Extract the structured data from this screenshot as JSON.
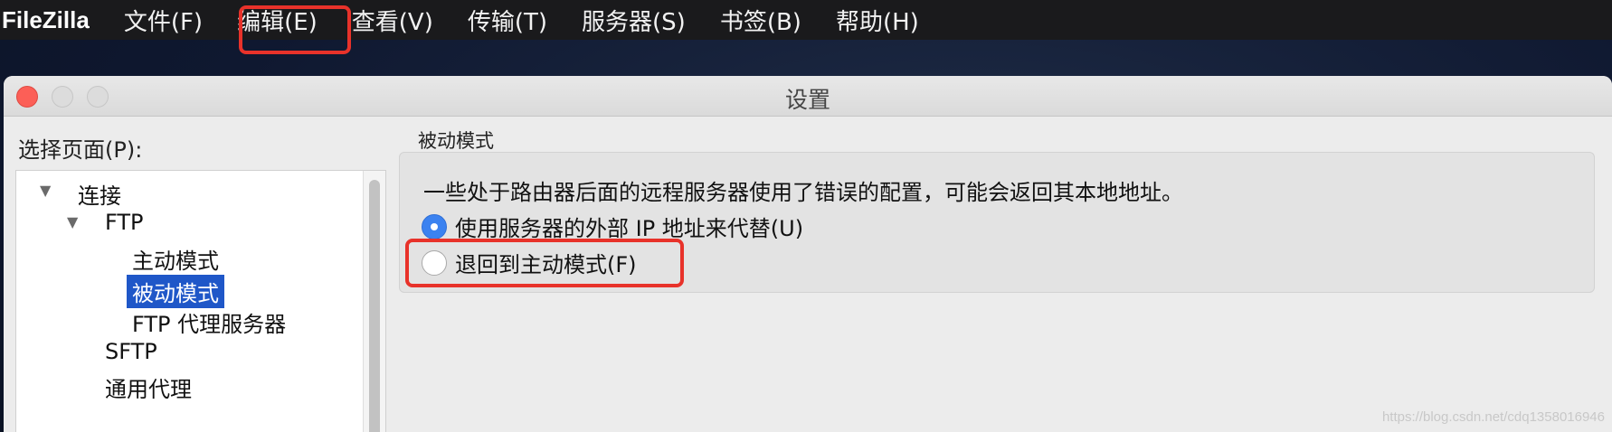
{
  "menubar": {
    "app_name": "FileZilla",
    "items": [
      "文件(F)",
      "编辑(E)",
      "查看(V)",
      "传输(T)",
      "服务器(S)",
      "书签(B)",
      "帮助(H)"
    ]
  },
  "dialog": {
    "title": "设置",
    "page_select_label": "选择页面(P):",
    "tree": {
      "connection": "连接",
      "ftp": "FTP",
      "active_mode": "主动模式",
      "passive_mode": "被动模式",
      "ftp_proxy": "FTP 代理服务器",
      "sftp": "SFTP",
      "generic_proxy": "通用代理"
    },
    "section_title": "被动模式",
    "description": "一些处于路由器后面的远程服务器使用了错误的配置，可能会返回其本地地址。",
    "options": {
      "use_external_ip": {
        "label": "使用服务器的外部 IP 地址来代替(U)",
        "selected": true
      },
      "fallback_active": {
        "label": "退回到主动模式(F)",
        "selected": false
      }
    }
  },
  "watermark": "https://blog.csdn.net/cdq1358016946",
  "colors": {
    "highlight": "#e8322a",
    "selection": "#1f57c8",
    "radio_on": "#3b82f0"
  }
}
